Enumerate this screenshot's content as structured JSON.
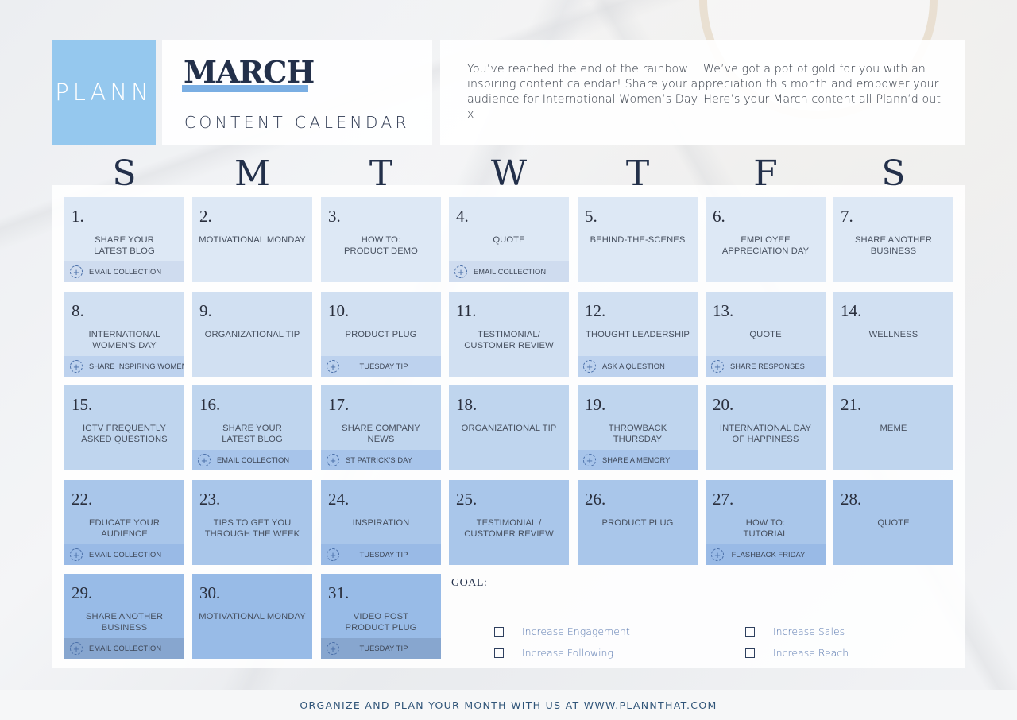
{
  "brand": {
    "logo": "PLANN",
    "accent_color": "#95c8ee"
  },
  "header": {
    "month": "MARCH",
    "subtitle": "CONTENT CALENDAR",
    "intro": "You’ve reached the end of the rainbow… We’ve got a pot of gold for you with an inspiring content calendar! Share your appreciation this month and empower your audience for International Women’s Day. Here’s your March content all Plann’d out x"
  },
  "weekdays": [
    "S",
    "M",
    "T",
    "W",
    "T",
    "F",
    "S"
  ],
  "days": [
    {
      "num": "1.",
      "topic": "SHARE YOUR\nLATEST BLOG",
      "tag": "EMAIL COLLECTION",
      "tag_align": "left",
      "tag_icon": "plus-circle-icon"
    },
    {
      "num": "2.",
      "topic": "MOTIVATIONAL MONDAY"
    },
    {
      "num": "3.",
      "topic": "HOW TO:\nPRODUCT DEMO"
    },
    {
      "num": "4.",
      "topic": "QUOTE",
      "tag": "EMAIL COLLECTION",
      "tag_align": "left",
      "tag_icon": "plus-circle-icon"
    },
    {
      "num": "5.",
      "topic": "BEHIND-THE-SCENES"
    },
    {
      "num": "6.",
      "topic": "EMPLOYEE\nAPPRECIATION DAY"
    },
    {
      "num": "7.",
      "topic": "SHARE ANOTHER\nBUSINESS"
    },
    {
      "num": "8.",
      "topic": "INTERNATIONAL\nWOMEN’S DAY",
      "tag": "SHARE INSPIRING WOMEN",
      "tag_align": "left",
      "tag_icon": "plus-circle-icon"
    },
    {
      "num": "9.",
      "topic": "ORGANIZATIONAL TIP"
    },
    {
      "num": "10.",
      "topic": "PRODUCT PLUG",
      "tag": "TUESDAY TIP",
      "tag_align": "center",
      "tag_icon": "plus-circle-icon"
    },
    {
      "num": "11.",
      "topic": "TESTIMONIAL/\nCUSTOMER REVIEW"
    },
    {
      "num": "12.",
      "topic": "THOUGHT LEADERSHIP",
      "tag": "ASK A QUESTION",
      "tag_align": "left",
      "tag_icon": "plus-circle-icon"
    },
    {
      "num": "13.",
      "topic": "QUOTE",
      "tag": "SHARE RESPONSES",
      "tag_align": "left",
      "tag_icon": "plus-circle-icon"
    },
    {
      "num": "14.",
      "topic": "WELLNESS"
    },
    {
      "num": "15.",
      "topic": "IGTV FREQUENTLY\nASKED QUESTIONS"
    },
    {
      "num": "16.",
      "topic": "SHARE YOUR\nLATEST BLOG",
      "tag": "EMAIL COLLECTION",
      "tag_align": "left",
      "tag_icon": "plus-circle-icon"
    },
    {
      "num": "17.",
      "topic": "SHARE COMPANY\nNEWS",
      "tag": "ST PATRICK’S DAY",
      "tag_align": "left",
      "tag_icon": "plus-circle-icon"
    },
    {
      "num": "18.",
      "topic": "ORGANIZATIONAL TIP"
    },
    {
      "num": "19.",
      "topic": "THROWBACK\nTHURSDAY",
      "tag": "SHARE A MEMORY",
      "tag_align": "left",
      "tag_icon": "plus-circle-icon"
    },
    {
      "num": "20.",
      "topic": "INTERNATIONAL DAY\nOF HAPPINESS"
    },
    {
      "num": "21.",
      "topic": "MEME"
    },
    {
      "num": "22.",
      "topic": "EDUCATE YOUR\nAUDIENCE",
      "tag": "EMAIL COLLECTION",
      "tag_align": "left",
      "tag_icon": "plus-circle-icon"
    },
    {
      "num": "23.",
      "topic": "TIPS TO GET YOU\nTHROUGH THE WEEK"
    },
    {
      "num": "24.",
      "topic": "INSPIRATION",
      "tag": "TUESDAY TIP",
      "tag_align": "center",
      "tag_icon": "plus-circle-icon"
    },
    {
      "num": "25.",
      "topic": "TESTIMONIAL /\nCUSTOMER REVIEW"
    },
    {
      "num": "26.",
      "topic": "PRODUCT PLUG"
    },
    {
      "num": "27.",
      "topic": "HOW TO:\nTUTORIAL",
      "tag": "FLASHBACK FRIDAY",
      "tag_align": "center",
      "tag_icon": "plus-circle-icon"
    },
    {
      "num": "28.",
      "topic": "QUOTE"
    },
    {
      "num": "29.",
      "topic": "SHARE ANOTHER\nBUSINESS",
      "tag": "EMAIL COLLECTION",
      "tag_align": "left",
      "tag_icon": "plus-circle-icon"
    },
    {
      "num": "30.",
      "topic": "MOTIVATIONAL MONDAY"
    },
    {
      "num": "31.",
      "topic": "VIDEO POST\nPRODUCT PLUG",
      "tag": "TUESDAY TIP",
      "tag_align": "center",
      "tag_icon": "plus-circle-icon"
    }
  ],
  "goal": {
    "label": "GOAL:",
    "options": [
      {
        "label": "Increase Engagement",
        "checked": false
      },
      {
        "label": "Increase Sales",
        "checked": false
      },
      {
        "label": "Increase Following",
        "checked": false
      },
      {
        "label": "Increase Reach",
        "checked": false
      }
    ]
  },
  "footer": {
    "text": "ORGANIZE AND PLAN YOUR MONTH WITH US AT WWW.PLANNTHAT.COM"
  }
}
